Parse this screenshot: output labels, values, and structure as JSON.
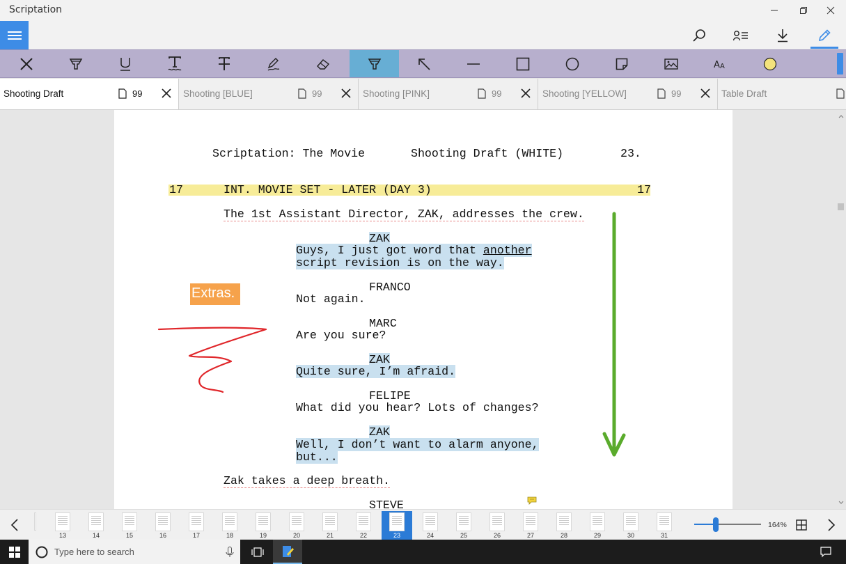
{
  "window": {
    "title": "Scriptation"
  },
  "tabs": [
    {
      "name": "Shooting Draft",
      "pages": "99",
      "active": true
    },
    {
      "name": "Shooting [BLUE]",
      "pages": "99",
      "active": false
    },
    {
      "name": "Shooting [PINK]",
      "pages": "99",
      "active": false
    },
    {
      "name": "Shooting [YELLOW]",
      "pages": "99",
      "active": false
    },
    {
      "name": "Table Draft",
      "pages": "",
      "active": false
    }
  ],
  "toolbar": {
    "tools": [
      "close-tool",
      "highlighter",
      "underline",
      "text-underline",
      "strikethrough",
      "pen",
      "eraser",
      "highlighter-selected",
      "arrow",
      "line",
      "rectangle",
      "circle",
      "note",
      "image",
      "text-size",
      "color"
    ],
    "selected": "highlighter-selected",
    "color_swatch": "#f3e37c",
    "toolbar_bg": "#b7afcd",
    "selected_bg": "#67aed4"
  },
  "script": {
    "header_title": "Scriptation: The Movie",
    "header_draft": "Shooting Draft (WHITE)",
    "header_page": "23.",
    "scene_number_left": "17",
    "scene_heading": "INT. MOVIE SET - LATER (DAY 3)",
    "scene_number_right": "17",
    "action1": "The 1st Assistant Director, ZAK, addresses the crew.",
    "char1": "ZAK",
    "dlg1_line1_a": "Guys, I just got word that ",
    "dlg1_line1_b": "another",
    "dlg1_line2": "script revision is on the way.",
    "char2": "FRANCO",
    "dlg2": "Not again.",
    "char3": "MARC",
    "dlg3": "Are you sure?",
    "char4": "ZAK",
    "dlg4": "Quite sure, I’m afraid.",
    "char5": "FELIPE",
    "dlg5": "What did you hear? Lots of changes?",
    "char6": "ZAK",
    "dlg6_line1": "Well, I don’t want to alarm anyone,",
    "dlg6_line2": "but...",
    "action2": "Zak takes a deep breath.",
    "char7": "STEVE"
  },
  "annotations": {
    "sticky_note": "Extras.",
    "sticky_color": "#f6a24b",
    "ink_color": "#e0262a",
    "arrow_color": "#5aab2c",
    "highlight_blue": "#c9e0ef",
    "highlight_yellow": "#f7ec98"
  },
  "thumbnails": [
    "13",
    "14",
    "15",
    "16",
    "17",
    "18",
    "19",
    "20",
    "21",
    "22",
    "23",
    "24",
    "25",
    "26",
    "27",
    "28",
    "29",
    "30",
    "31"
  ],
  "current_page": "23",
  "zoom": {
    "label": "164%",
    "value": 164
  },
  "taskbar": {
    "search_placeholder": "Type here to search"
  }
}
